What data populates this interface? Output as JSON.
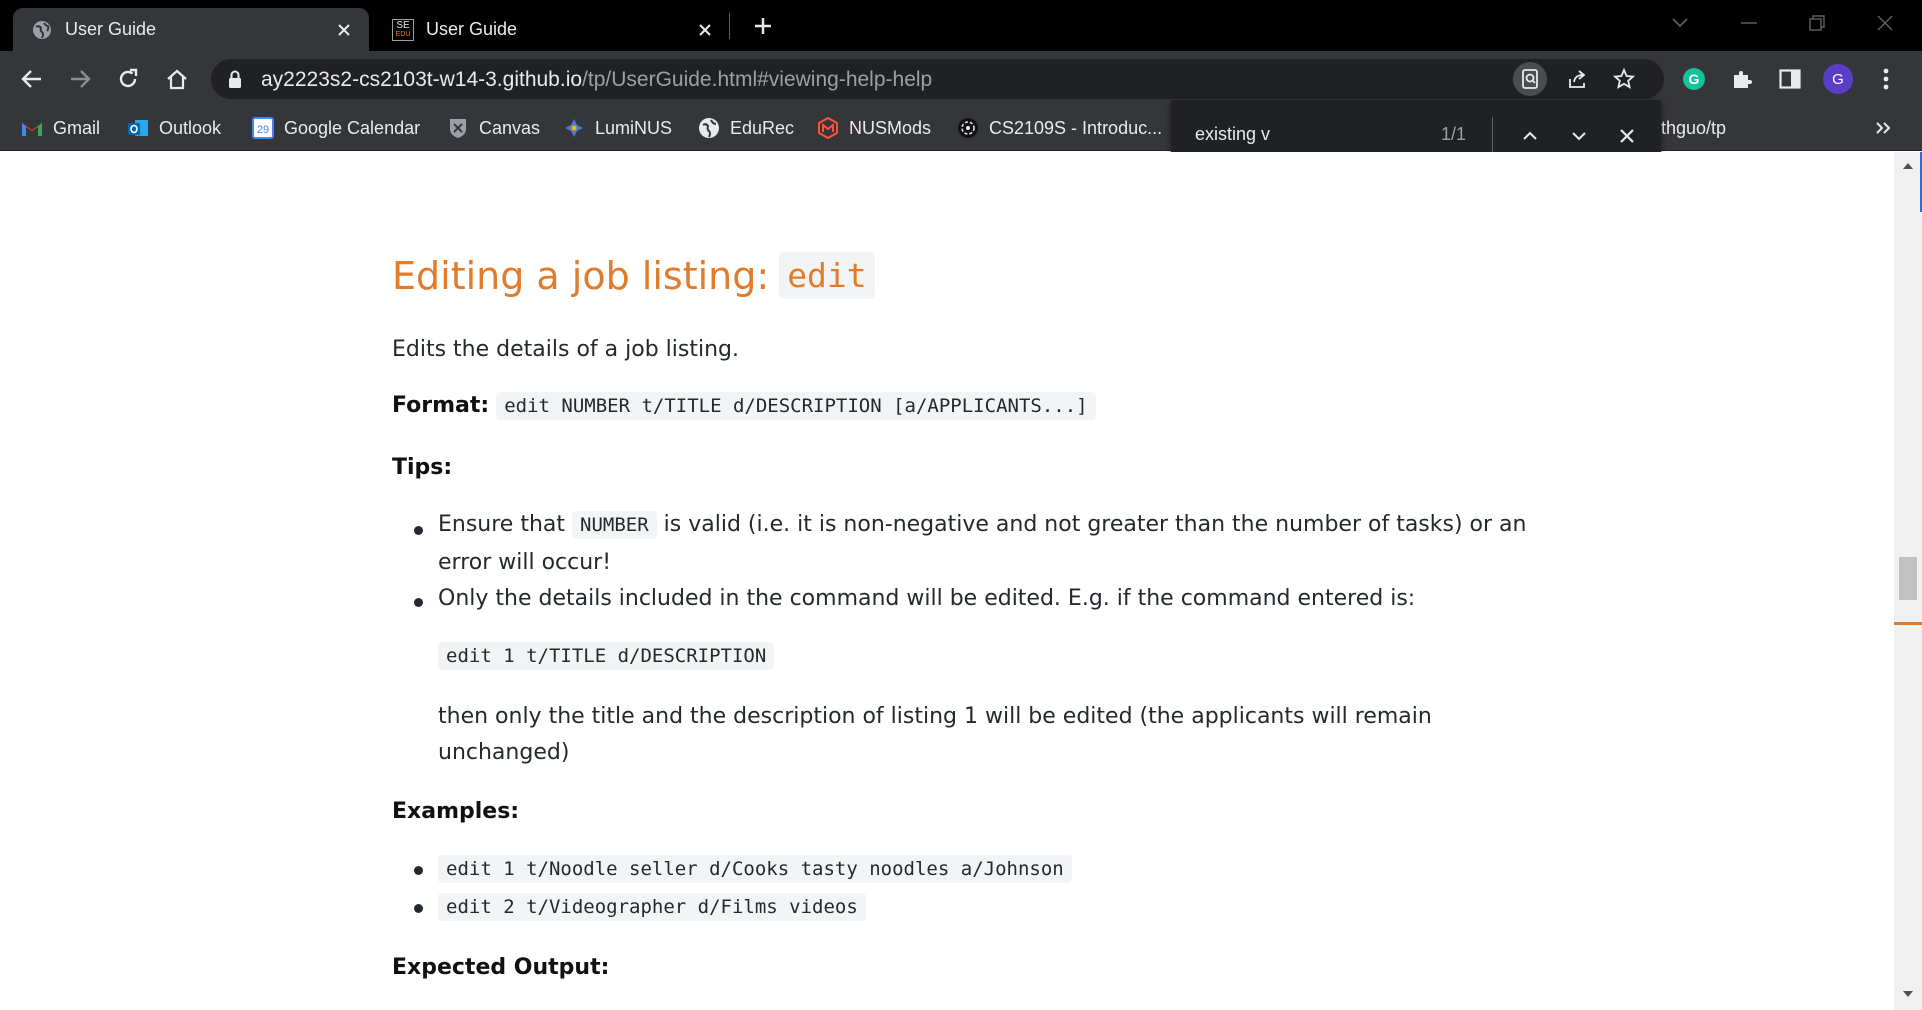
{
  "tabs": [
    {
      "title": "User Guide",
      "active": true,
      "icon": "globe-icon"
    },
    {
      "title": "User Guide",
      "active": false,
      "icon": "se-edu-icon",
      "icon_text_top": "SE",
      "icon_text_bottom": "EDU"
    }
  ],
  "toolbar": {
    "url_host": "ay2223s2-cs2103t-w14-3.github.io",
    "url_path": "/tp/UserGuide.html#viewing-help-help",
    "profile_initial": "G"
  },
  "bookmarks": [
    {
      "label": "Gmail",
      "icon": "gmail-icon"
    },
    {
      "label": "Outlook",
      "icon": "outlook-icon"
    },
    {
      "label": "Google Calendar",
      "icon": "calendar-icon",
      "icon_text": "29"
    },
    {
      "label": "Canvas",
      "icon": "canvas-icon"
    },
    {
      "label": "LumiNUS",
      "icon": "luminus-icon"
    },
    {
      "label": "EduRec",
      "icon": "edurec-icon"
    },
    {
      "label": "NUSMods",
      "icon": "nusmods-icon"
    },
    {
      "label": "CS2109S - Introduc...",
      "icon": "cs2109s-icon"
    },
    {
      "label": "thguo/tp",
      "icon": ""
    }
  ],
  "findbar": {
    "query": "existing v",
    "count": "1/1"
  },
  "doc": {
    "heading": "Editing a job listing:",
    "heading_code": "edit",
    "intro": "Edits the details of a job listing.",
    "format_label": "Format:",
    "format_code": "edit NUMBER t/TITLE d/DESCRIPTION [a/APPLICANTS...]",
    "tips_label": "Tips:",
    "tip1_pre": "Ensure that",
    "tip1_code": "NUMBER",
    "tip1_post": "is valid (i.e. it is non-negative and not greater than the number of tasks) or an",
    "tip1_cont": "error will occur!",
    "tip2": "Only the details included in the command will be edited. E.g. if the command entered is:",
    "tip2_code": "edit 1 t/TITLE d/DESCRIPTION",
    "tip2_after1": "then only the title and the description of listing 1 will be edited (the applicants will remain",
    "tip2_after2": "unchanged)",
    "examples_label": "Examples:",
    "example1": "edit 1 t/Noodle seller d/Cooks tasty noodles a/Johnson",
    "example2": "edit 2 t/Videographer d/Films videos",
    "expected_label": "Expected Output:"
  },
  "colors": {
    "heading": "#e07c2c",
    "tab_active_bg": "#35363a",
    "omnibox_bg": "#202124",
    "profile_bg": "#5b3ec6",
    "grammarly": "#15c39a"
  }
}
